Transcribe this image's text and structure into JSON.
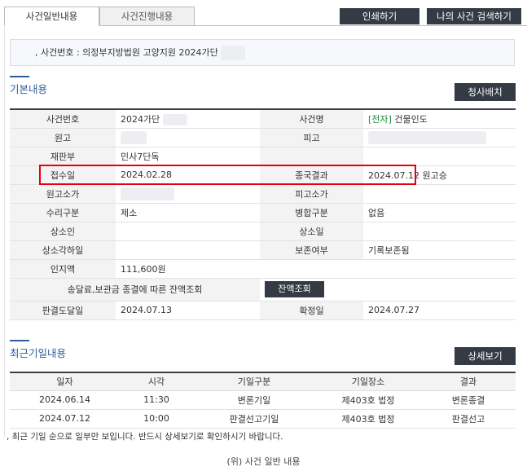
{
  "tabs": [
    {
      "label": "사건일반내용"
    },
    {
      "label": "사건진행내용"
    }
  ],
  "toolbar": {
    "print_label": "인쇄하기",
    "search_label": "나의 사건 검색하기"
  },
  "case_header": {
    "text": ", 사건번호 : 의정부지방법원 고양지원 2024가단"
  },
  "sections": {
    "basic_title": "기본내용",
    "clear_label": "청사배치",
    "recent_title": "최근기일내용",
    "detail_label": "상세보기"
  },
  "info": {
    "case_no_label": "사건번호",
    "case_no_value": "2024가단",
    "case_name_label": "사건명",
    "case_name_tag": "[전자]",
    "case_name_value": " 건물인도",
    "plaintiff_label": "원고",
    "defendant_label": "피고",
    "court_label": "재판부",
    "court_value": "민사7단독",
    "receipt_label": "접수일",
    "receipt_value": "2024.02.28",
    "result_label": "종국결과",
    "result_value": "2024.07.12 원고승",
    "p_lawyer_label": "원고소가",
    "d_lawyer_label": "피고소가",
    "type_label": "수리구분",
    "type_value": "제소",
    "merge_label": "병합구분",
    "merge_value": "없음",
    "appellant_label": "상소인",
    "appeal_date_label": "상소일",
    "appeal_reject_label": "상소각하일",
    "preserve_label": "보존여부",
    "preserve_value": "기록보존됨",
    "stamp_label": "인지액",
    "stamp_value": "111,600원",
    "balance_label": "송달료,보관금 종결에 따른 잔액조회",
    "balance_button": "잔액조회",
    "delivery_label": "판결도달일",
    "delivery_value": "2024.07.13",
    "confirm_label": "확정일",
    "confirm_value": "2024.07.27"
  },
  "recent": {
    "headers": [
      "일자",
      "시각",
      "기일구분",
      "기일장소",
      "결과"
    ],
    "rows": [
      [
        "2024.06.14",
        "11:30",
        "변론기일",
        "제403호 법정",
        "변론종결"
      ],
      [
        "2024.07.12",
        "10:00",
        "판결선고기일",
        "제403호 법정",
        "판결선고"
      ]
    ]
  },
  "note": ", 최근 기일 순으로 일부만 보입니다. 반드시 상세보기로 확인하시기 바랍니다.",
  "caption": "(위) 사건 일반 내용",
  "colors": {
    "accent": "#2b5c9a",
    "dark_button": "#343b44",
    "highlight": "#e60012",
    "electronic_tag": "#1a8a3a"
  }
}
